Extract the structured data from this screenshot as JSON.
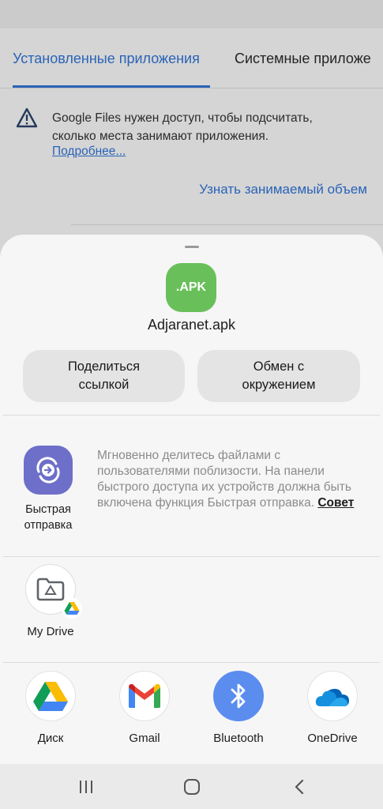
{
  "background": {
    "tabs": [
      {
        "label": "Установленные приложения"
      },
      {
        "label": "Системные приложе"
      }
    ],
    "warning_text": "Google Files нужен доступ, чтобы подсчитать, сколько места занимают приложения.",
    "learn_more_link": "Подробнее...",
    "action_link": "Узнать занимаемый объем"
  },
  "share_sheet": {
    "file_badge": ".APK",
    "file_name": "Adjaranet.apk",
    "share_link_button": "Поделиться ссылкой",
    "nearby_button": "Обмен с окружением",
    "quick_share": {
      "label": "Быстрая отправка",
      "description": "Мгновенно делитесь файлами с пользователями поблизости. На панели быстрого доступа их устройств должна быть включена функция Быстрая отправка.",
      "tip_link": "Совет"
    },
    "direct_target": {
      "label": "My Drive"
    },
    "apps": [
      {
        "label": "Диск",
        "icon": "google-drive-icon"
      },
      {
        "label": "Gmail",
        "icon": "gmail-icon"
      },
      {
        "label": "Bluetooth",
        "icon": "bluetooth-icon"
      },
      {
        "label": "OneDrive",
        "icon": "onedrive-icon"
      }
    ]
  },
  "colors": {
    "accent": "#2a63b8",
    "apk_green": "#69c05a",
    "quick_share_purple": "#6d6fc9",
    "bluetooth_blue": "#5b8def"
  },
  "navigation": {
    "buttons": [
      "recents-icon",
      "home-icon",
      "back-icon"
    ]
  }
}
